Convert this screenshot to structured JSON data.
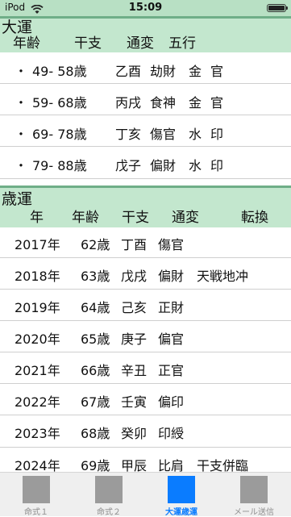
{
  "status": {
    "carrier": "iPod",
    "time": "15:09"
  },
  "taiun": {
    "title": "大運",
    "columns": {
      "age": "年齢",
      "kanshi": "干支",
      "tsuhen": "通変",
      "gogyo": "五行"
    },
    "rows": [
      {
        "bullet": "・",
        "range": "49- 58歳",
        "kanshi": "乙酉",
        "tsuhen": "劫財",
        "gogyo": "金",
        "star": "官"
      },
      {
        "bullet": "・",
        "range": "59- 68歳",
        "kanshi": "丙戌",
        "tsuhen": "食神",
        "gogyo": "金",
        "star": "官"
      },
      {
        "bullet": "・",
        "range": "69- 78歳",
        "kanshi": "丁亥",
        "tsuhen": "傷官",
        "gogyo": "水",
        "star": "印"
      },
      {
        "bullet": "・",
        "range": "79- 88歳",
        "kanshi": "戊子",
        "tsuhen": "偏財",
        "gogyo": "水",
        "star": "印"
      }
    ]
  },
  "saiun": {
    "title": "歳運",
    "columns": {
      "year": "年",
      "age": "年齢",
      "kanshi": "干支",
      "tsuhen": "通変",
      "tenkan": "転換"
    },
    "rows": [
      {
        "year": "2017年",
        "age": "62歳",
        "kanshi": "丁酉",
        "tsuhen": "傷官",
        "tenkan": ""
      },
      {
        "year": "2018年",
        "age": "63歳",
        "kanshi": "戊戌",
        "tsuhen": "偏財",
        "tenkan": "天戦地冲"
      },
      {
        "year": "2019年",
        "age": "64歳",
        "kanshi": "己亥",
        "tsuhen": "正財",
        "tenkan": ""
      },
      {
        "year": "2020年",
        "age": "65歳",
        "kanshi": "庚子",
        "tsuhen": "偏官",
        "tenkan": ""
      },
      {
        "year": "2021年",
        "age": "66歳",
        "kanshi": "辛丑",
        "tsuhen": "正官",
        "tenkan": ""
      },
      {
        "year": "2022年",
        "age": "67歳",
        "kanshi": "壬寅",
        "tsuhen": "偏印",
        "tenkan": ""
      },
      {
        "year": "2023年",
        "age": "68歳",
        "kanshi": "癸卯",
        "tsuhen": "印綬",
        "tenkan": ""
      },
      {
        "year": "2024年",
        "age": "69歳",
        "kanshi": "甲辰",
        "tsuhen": "比肩",
        "tenkan": "干支併臨"
      }
    ]
  },
  "tabs": [
    {
      "label": "命式１",
      "active": false
    },
    {
      "label": "命式２",
      "active": false
    },
    {
      "label": "大運歳運",
      "active": true
    },
    {
      "label": "メール送信",
      "active": false
    }
  ],
  "colors": {
    "header_bg": "#c3e7ce",
    "header_line": "#6fae88",
    "active_tab": "#0a7cff",
    "inactive_tab": "#9b9b9b"
  }
}
